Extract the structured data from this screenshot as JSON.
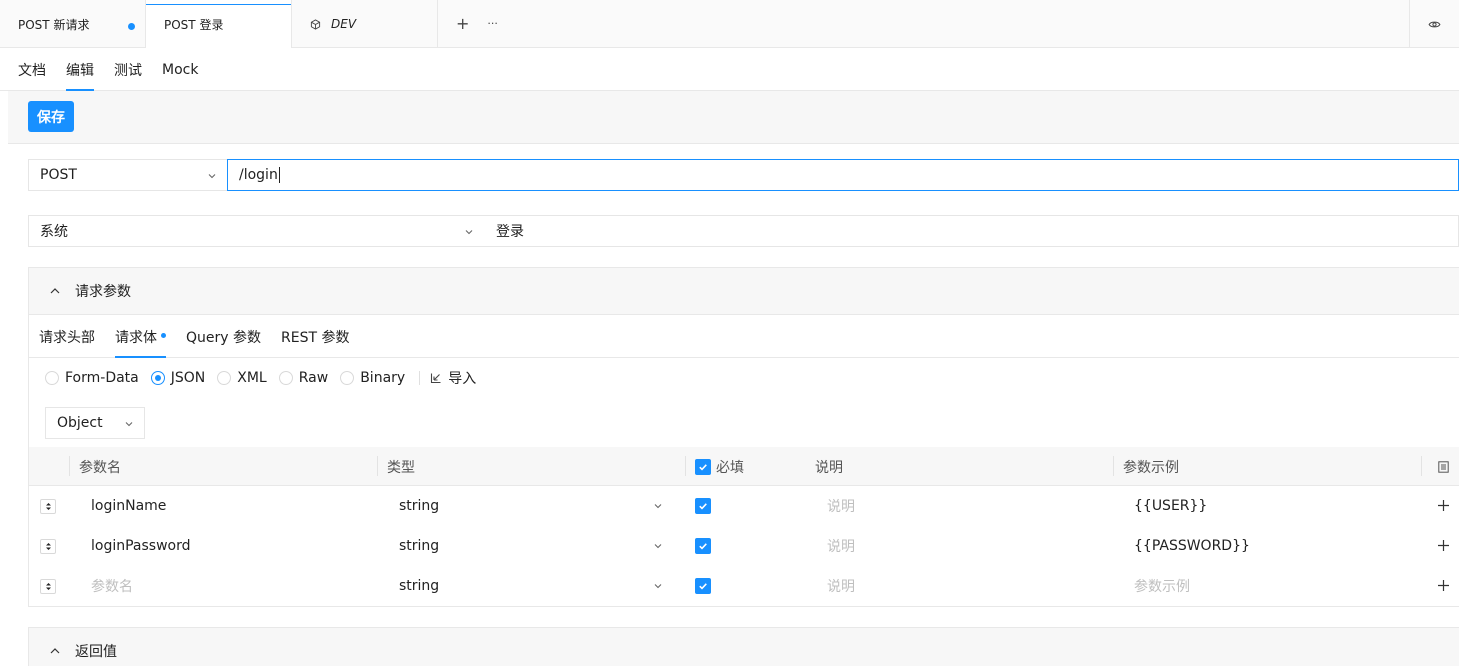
{
  "tabs": [
    {
      "label": "POST 新请求",
      "modified": true,
      "active": false
    },
    {
      "label": "POST 登录",
      "modified": false,
      "active": true
    },
    {
      "label": "DEV",
      "environment": true,
      "active": false
    }
  ],
  "tab_actions": {
    "add": "+",
    "more": "···"
  },
  "mode_tabs": [
    {
      "label": "文档",
      "active": false
    },
    {
      "label": "编辑",
      "active": true
    },
    {
      "label": "测试",
      "active": false
    },
    {
      "label": "Mock",
      "active": false
    }
  ],
  "toolbar": {
    "save_label": "保存"
  },
  "request": {
    "method": "POST",
    "url": "/login",
    "group": "系统",
    "name": "登录"
  },
  "params_panel": {
    "title": "请求参数",
    "subtabs": [
      {
        "label": "请求头部",
        "active": false
      },
      {
        "label": "请求体",
        "active": true,
        "dot": true
      },
      {
        "label": "Query 参数",
        "active": false
      },
      {
        "label": "REST 参数",
        "active": false
      }
    ],
    "body_types": [
      {
        "label": "Form-Data",
        "selected": false
      },
      {
        "label": "JSON",
        "selected": true
      },
      {
        "label": "XML",
        "selected": false
      },
      {
        "label": "Raw",
        "selected": false
      },
      {
        "label": "Binary",
        "selected": false
      }
    ],
    "import_label": "导入",
    "root_type": "Object",
    "columns": {
      "name": "参数名",
      "type": "类型",
      "required": "必填",
      "description": "说明",
      "example": "参数示例"
    },
    "rows": [
      {
        "name": "loginName",
        "type": "string",
        "required": true,
        "description": "",
        "description_placeholder": "说明",
        "example": "{{USER}}"
      },
      {
        "name": "loginPassword",
        "type": "string",
        "required": true,
        "description": "",
        "description_placeholder": "说明",
        "example": "{{PASSWORD}}"
      },
      {
        "name": "",
        "name_placeholder": "参数名",
        "type": "string",
        "required": true,
        "description": "",
        "description_placeholder": "说明",
        "example": "",
        "example_placeholder": "参数示例"
      }
    ]
  },
  "return_panel": {
    "title": "返回值"
  },
  "colors": {
    "accent": "#1890ff",
    "border": "#e8e8e8",
    "panel_bg": "#f7f7f7",
    "placeholder": "#bfbfbf"
  }
}
